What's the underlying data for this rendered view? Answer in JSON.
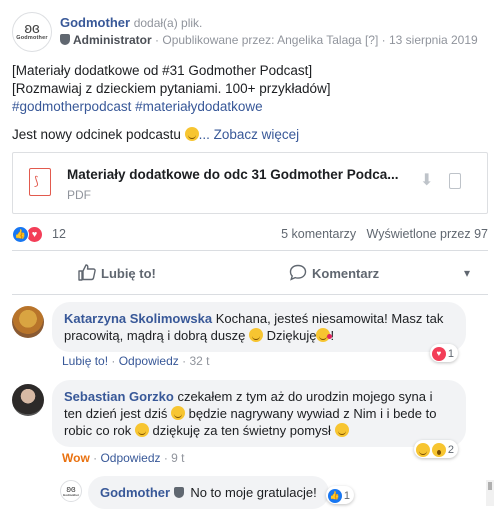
{
  "post": {
    "author": "Godmother",
    "action": "dodał(a) plik.",
    "logo_text": "Godmother",
    "role": "Administrator",
    "published_by": "Opublikowane przez: Angelika Talaga",
    "help_mark": "[?]",
    "date": "13 sierpnia 2019",
    "text_lines": [
      "[Materiały dodatkowe od #31 Godmother Podcast]",
      "[Rozmawiaj z dzieckiem pytaniami. 100+ przykładów]"
    ],
    "hashtags": "#godmotherpodcast #materiałydodatkowe",
    "teaser": "Jest nowy odcinek podcastu",
    "more_link": "... Zobacz więcej"
  },
  "attachment": {
    "title": "Materiały dodatkowe do odc 31 Godmother Podca...",
    "type": "PDF"
  },
  "reactions": {
    "count": "12",
    "comments": "5 komentarzy",
    "views": "Wyświetlone przez 97"
  },
  "actions": {
    "like": "Lubię to!",
    "comment": "Komentarz"
  },
  "comments": [
    {
      "name": "Katarzyna Skolimowska",
      "text_a": "Kochana, jesteś niesamowita! Masz tak",
      "text_b": "pracowitą, mądrą i dobrą duszę",
      "text_c": "Dziękuję",
      "text_d": "!",
      "like": "Lubię to!",
      "reply": "Odpowiedz",
      "time": "32 t",
      "react_count": "1"
    },
    {
      "name": "Sebastian Gorzko",
      "text_a": "czekałem z tym aż do urodzin mojego syna i ten",
      "text_b": "dzień jest dziś",
      "text_c": "będzie nagrywany wywiad z Nim i i bede to robic",
      "text_d": "co rok",
      "text_e": "dziękuję za ten świetny pomysł",
      "like": "Wow",
      "reply": "Odpowiedz",
      "time": "9 t",
      "react_count": "2"
    }
  ],
  "reply": {
    "name": "Godmother",
    "text": "No to moje gratulacje!",
    "logo_text": "Godmother",
    "react_count": "1"
  },
  "colors": {
    "link": "#385898",
    "like_blue": "#1877f2",
    "love_red": "#f33e58",
    "wow_orange": "#e9710f"
  }
}
